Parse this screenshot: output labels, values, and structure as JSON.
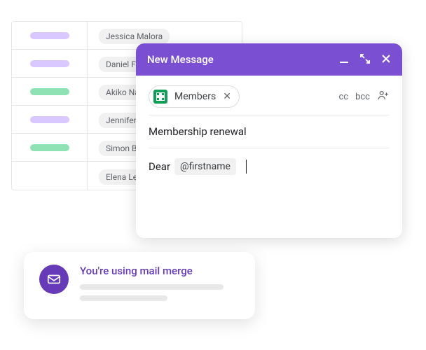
{
  "contacts": {
    "pill_colors": [
      "#d9c8ff",
      "#d9c8ff",
      "#8fe2b4",
      "#d9c8ff",
      "#8fe2b4",
      null
    ],
    "names": [
      "Jessica Malora",
      "Daniel Ferr",
      "Akiko Naka",
      "Jennifer Ac",
      "Simon Balli",
      "Elena Lee"
    ]
  },
  "compose": {
    "title": "New Message",
    "recipient_label": "Members",
    "cc": "cc",
    "bcc": "bcc",
    "subject": "Membership renewal",
    "body_greeting": "Dear",
    "merge_var": "@firstname"
  },
  "toast": {
    "title": "You're using mail merge"
  }
}
